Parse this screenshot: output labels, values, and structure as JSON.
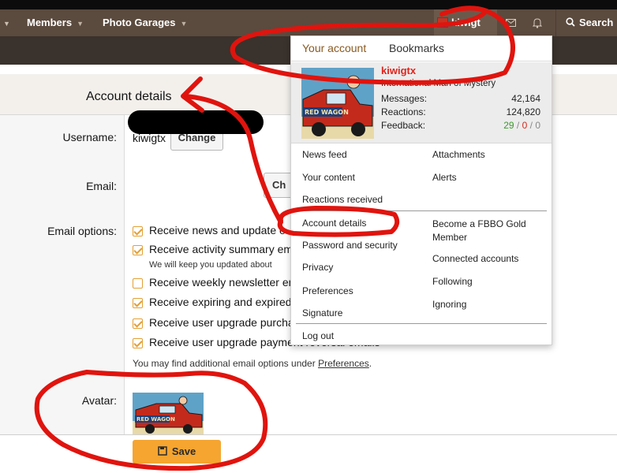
{
  "nav": {
    "members": "Members",
    "photo_garages": "Photo Garages",
    "username": "kiwigt",
    "search": "Search"
  },
  "account": {
    "title": "Account details",
    "username_label": "Username:",
    "username_value": "kiwigtx",
    "change": "Change",
    "email_label": "Email:",
    "email_change_partial": "Ch",
    "email_options_label": "Email options:",
    "options": [
      {
        "label": "Receive news and update e",
        "checked": true
      },
      {
        "label": "Receive activity summary em",
        "checked": true,
        "hint": "We will keep you updated about"
      },
      {
        "label": "Receive weekly newsletter em",
        "checked": false
      },
      {
        "label": "Receive expiring and expired",
        "checked": true
      },
      {
        "label": "Receive user upgrade purcha",
        "checked": true
      },
      {
        "label": "Receive user upgrade payment reversal emails",
        "checked": true
      }
    ],
    "more_options_prefix": "You may find additional email options under",
    "more_options_link": "Preferences",
    "more_options_suffix": ".",
    "avatar_label": "Avatar:",
    "save": "Save",
    "avatar_caption": "RED WAGON"
  },
  "menu": {
    "tabs": [
      "Your account",
      "Bookmarks"
    ],
    "name": "kiwigtx",
    "user_title": "International Man of Mystery",
    "stats": {
      "messages_label": "Messages:",
      "messages_value": "42,164",
      "reactions_label": "Reactions:",
      "reactions_value": "124,820",
      "feedback_label": "Feedback:",
      "feedback_pos": "29",
      "feedback_neu": "0",
      "feedback_neg": "0",
      "slash": " / "
    },
    "links_left": [
      "News feed",
      "Your content",
      "Reactions received"
    ],
    "links_right": [
      "Attachments",
      "Alerts"
    ],
    "links2_left": [
      "Account details",
      "Password and security",
      "Privacy",
      "Preferences",
      "Signature"
    ],
    "links2_right": [
      "Become a FBBO Gold Member",
      "Connected accounts",
      "Following",
      "Ignoring"
    ],
    "logout": "Log out"
  },
  "colors": {
    "nav_bg": "#5b4a3e",
    "accent_orange": "#f5a530",
    "annotation_red": "#e0140e",
    "name_red": "#e0241b"
  },
  "icons": [
    "envelope-icon",
    "bell-icon",
    "search-icon",
    "save-icon",
    "chevron-down-icon"
  ]
}
